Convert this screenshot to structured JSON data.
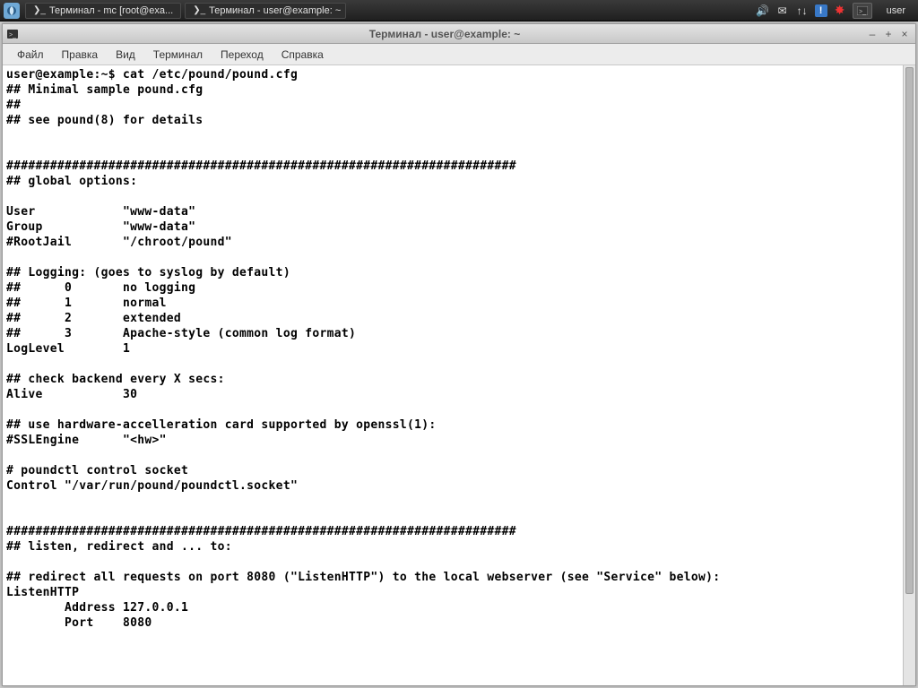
{
  "panel": {
    "task1": "Терминал - mc [root@exa...",
    "task2": "Терминал - user@example: ~",
    "user": "user"
  },
  "window": {
    "title": "Терминал - user@example: ~"
  },
  "menu": {
    "file": "Файл",
    "edit": "Правка",
    "view": "Вид",
    "terminal": "Терминал",
    "go": "Переход",
    "help": "Справка"
  },
  "terminal": {
    "lines": [
      "user@example:~$ cat /etc/pound/pound.cfg",
      "## Minimal sample pound.cfg",
      "##",
      "## see pound(8) for details",
      "",
      "",
      "######################################################################",
      "## global options:",
      "",
      "User            \"www-data\"",
      "Group           \"www-data\"",
      "#RootJail       \"/chroot/pound\"",
      "",
      "## Logging: (goes to syslog by default)",
      "##      0       no logging",
      "##      1       normal",
      "##      2       extended",
      "##      3       Apache-style (common log format)",
      "LogLevel        1",
      "",
      "## check backend every X secs:",
      "Alive           30",
      "",
      "## use hardware-accelleration card supported by openssl(1):",
      "#SSLEngine      \"<hw>\"",
      "",
      "# poundctl control socket",
      "Control \"/var/run/pound/poundctl.socket\"",
      "",
      "",
      "######################################################################",
      "## listen, redirect and ... to:",
      "",
      "## redirect all requests on port 8080 (\"ListenHTTP\") to the local webserver (see \"Service\" below):",
      "ListenHTTP",
      "        Address 127.0.0.1",
      "        Port    8080",
      ""
    ]
  }
}
